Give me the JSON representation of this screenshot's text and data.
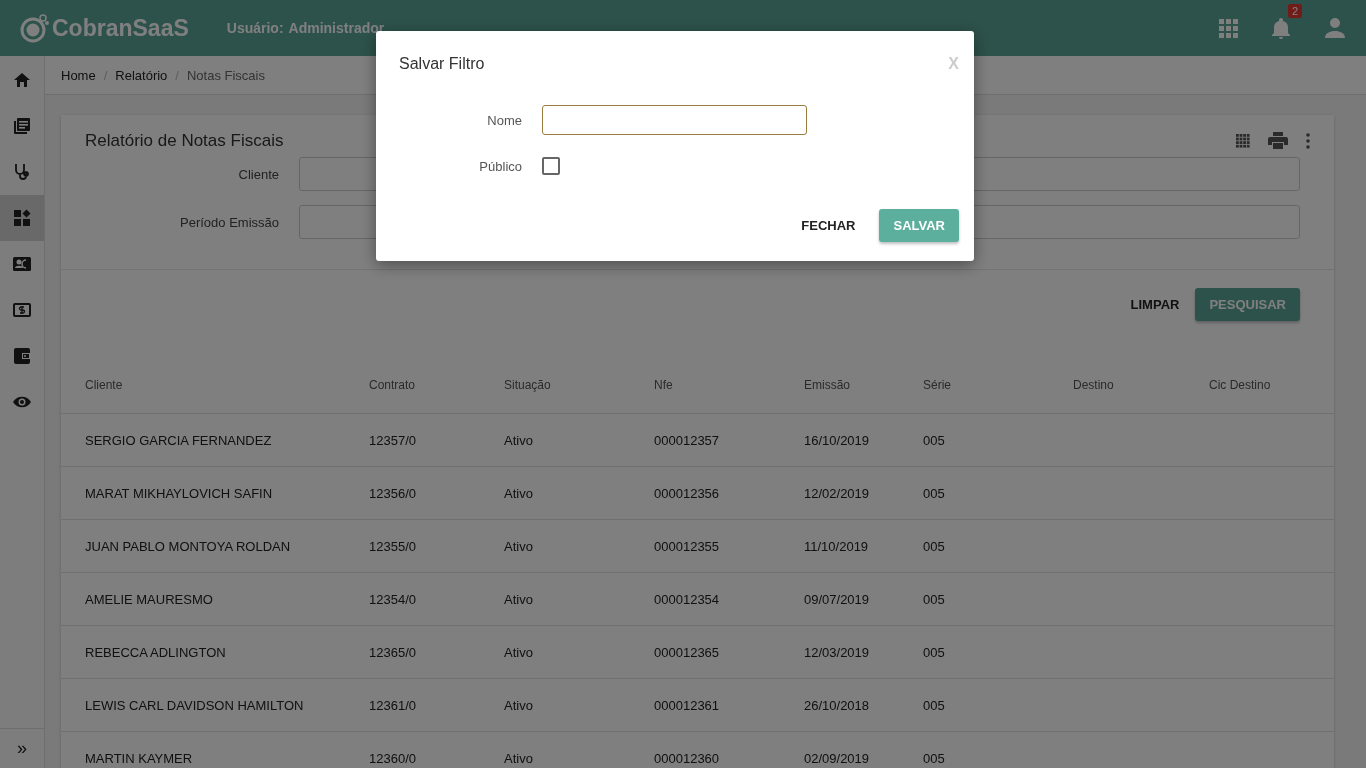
{
  "header": {
    "brand": "CobranSaaS",
    "user_label": "Usuário:",
    "user": "Administrador",
    "notifications": "2"
  },
  "sidebar": {
    "items": [
      {
        "kind": "home",
        "selected": false
      },
      {
        "kind": "book",
        "selected": false
      },
      {
        "kind": "stethoscope",
        "selected": false
      },
      {
        "kind": "dashboard",
        "selected": true
      },
      {
        "kind": "contact",
        "selected": false
      },
      {
        "kind": "money",
        "selected": false
      },
      {
        "kind": "wallet",
        "selected": false
      },
      {
        "kind": "eye",
        "selected": false
      }
    ],
    "expand": "»"
  },
  "breadcrumb": {
    "separator": "/",
    "items": [
      "Home",
      "Relatório",
      "Notas Fiscais"
    ]
  },
  "report": {
    "title": "Relatório de Notas Fiscais",
    "filters": [
      {
        "label": "Cliente"
      },
      {
        "label": "Período Emissão"
      }
    ],
    "buttons": [
      "LIMPAR",
      "PESQUISAR"
    ]
  },
  "table": {
    "columns": [
      "Cliente",
      "Contrato",
      "Situação",
      "Nfe",
      "Emissão",
      "Série",
      "Destino",
      "Cic Destino"
    ],
    "rows": [
      [
        "SERGIO GARCIA FERNANDEZ",
        "12357/0",
        "Ativo",
        "000012357",
        "16/10/2019",
        "005"
      ],
      [
        "MARAT MIKHAYLOVICH SAFIN",
        "12356/0",
        "Ativo",
        "000012356",
        "12/02/2019",
        "005"
      ],
      [
        "JUAN PABLO MONTOYA ROLDAN",
        "12355/0",
        "Ativo",
        "000012355",
        "11/10/2019",
        "005"
      ],
      [
        "AMELIE MAURESMO",
        "12354/0",
        "Ativo",
        "000012354",
        "09/07/2019",
        "005"
      ],
      [
        "REBECCA ADLINGTON",
        "12365/0",
        "Ativo",
        "000012365",
        "12/03/2019",
        "005"
      ],
      [
        "LEWIS CARL DAVIDSON HAMILTON",
        "12361/0",
        "Ativo",
        "000012361",
        "26/10/2018",
        "005"
      ],
      [
        "MARTIN KAYMER",
        "12360/0",
        "Ativo",
        "000012360",
        "02/09/2019",
        "005"
      ]
    ]
  },
  "dialog": {
    "title": "Salvar Filtro",
    "close": "X",
    "name_label": "Nome",
    "public_label": "Público",
    "public_checked": false,
    "buttons": [
      "FECHAR",
      "SALVAR"
    ]
  }
}
